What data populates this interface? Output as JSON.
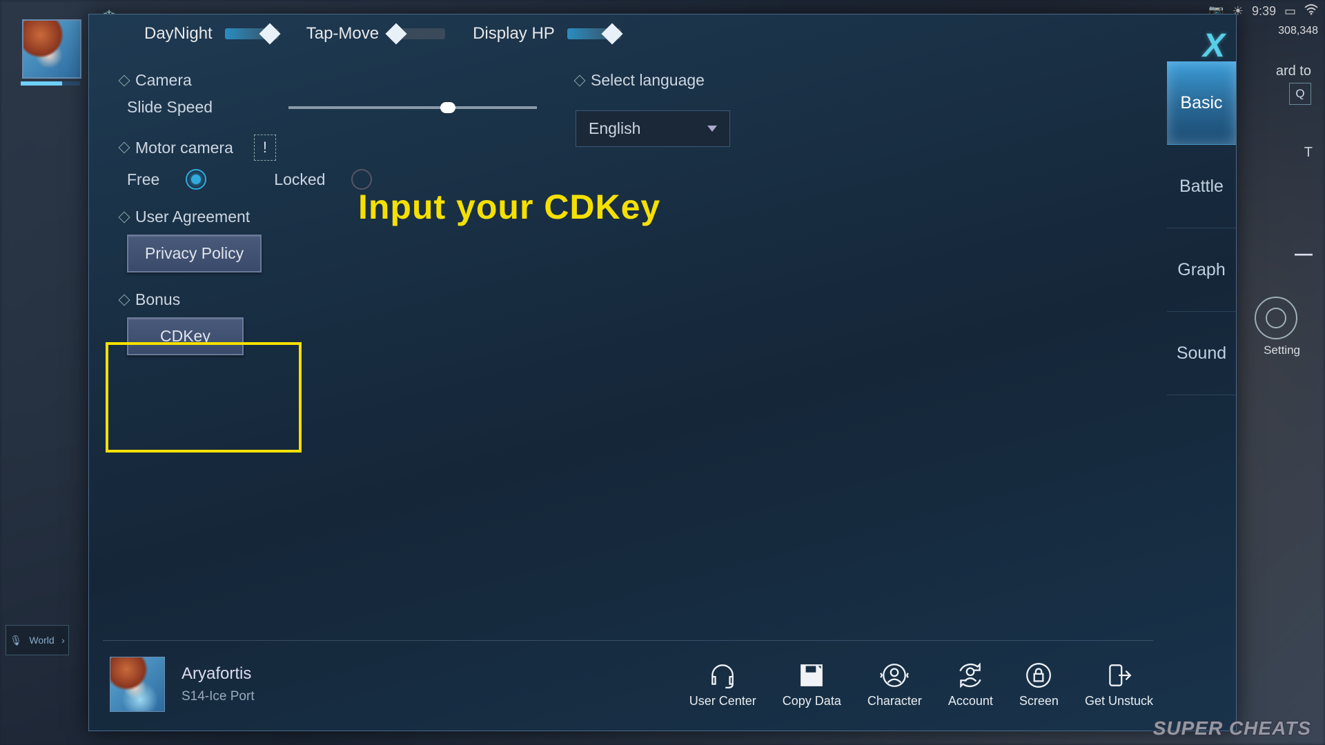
{
  "statusbar": {
    "time": "9:39",
    "currency": "308,348"
  },
  "toggles": {
    "daynight": {
      "label": "DayNight",
      "on": true
    },
    "tapmove": {
      "label": "Tap-Move",
      "on": false
    },
    "displayhp": {
      "label": "Display HP",
      "on": true
    }
  },
  "sections": {
    "camera": {
      "label": "Camera",
      "slide_label": "Slide Speed"
    },
    "motor": {
      "label": "Motor camera",
      "free": "Free",
      "locked": "Locked"
    },
    "agreement": {
      "label": "User Agreement",
      "btn": "Privacy Policy"
    },
    "bonus": {
      "label": "Bonus",
      "btn": "CDKey"
    },
    "lang": {
      "label": "Select language",
      "value": "English"
    }
  },
  "tabs": {
    "basic": "Basic",
    "battle": "Battle",
    "graph": "Graph",
    "sound": "Sound"
  },
  "player": {
    "name": "Aryafortis",
    "server": "S14-Ice Port"
  },
  "footer": {
    "usercenter": "User Center",
    "copydata": "Copy Data",
    "character": "Character",
    "account": "Account",
    "screen": "Screen",
    "unstuck": "Get Unstuck"
  },
  "bg": {
    "setting": "Setting",
    "hint": "ard to",
    "q": "Q",
    "t": "T",
    "world": "World"
  },
  "annotation": "Input your CDKey",
  "watermark": "SUPER CHEATS"
}
